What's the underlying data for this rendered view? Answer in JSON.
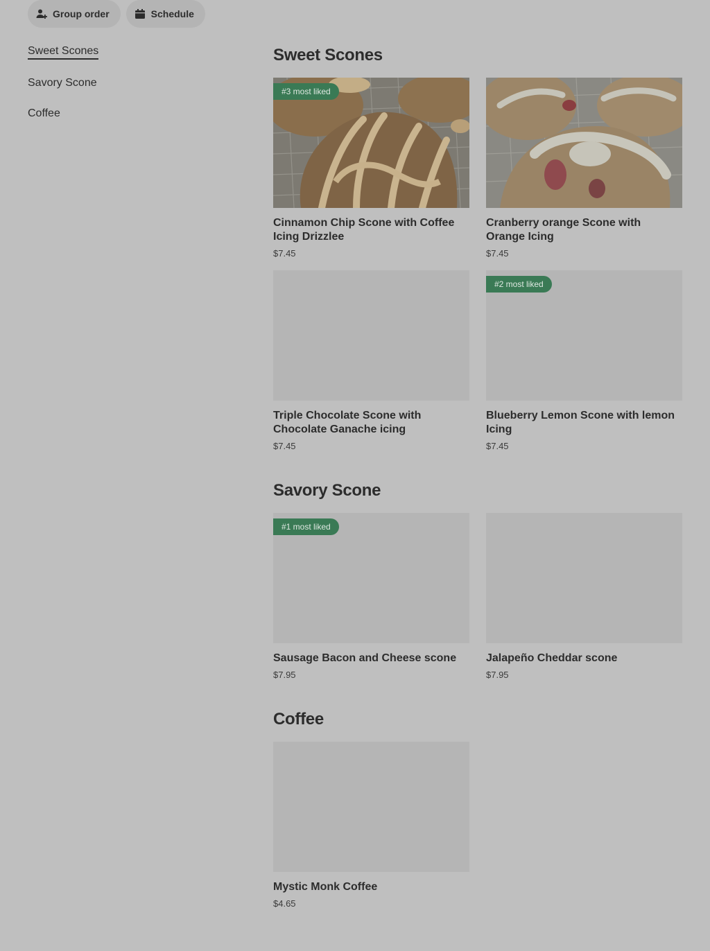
{
  "toolbar": {
    "group_order_label": "Group order",
    "schedule_label": "Schedule"
  },
  "nav": {
    "items": [
      {
        "label": "Sweet Scones",
        "active": true
      },
      {
        "label": "Savory Scone",
        "active": false
      },
      {
        "label": "Coffee",
        "active": false
      }
    ]
  },
  "sections": [
    {
      "title": "Sweet Scones",
      "items": [
        {
          "name": "Cinnamon Chip Scone with Coffee Icing Drizzlee",
          "price": "$7.45",
          "badge": "#3 most liked",
          "image": "scone-photo"
        },
        {
          "name": "Cranberry orange Scone with Orange Icing",
          "price": "$7.45",
          "badge": "",
          "image": "scone-photo"
        },
        {
          "name": "Triple Chocolate Scone with Chocolate Ganache icing",
          "price": "$7.45",
          "badge": "",
          "image": "placeholder"
        },
        {
          "name": "Blueberry Lemon Scone with lemon Icing",
          "price": "$7.45",
          "badge": "#2 most liked",
          "image": "placeholder"
        }
      ]
    },
    {
      "title": "Savory Scone",
      "items": [
        {
          "name": "Sausage Bacon and Cheese scone",
          "price": "$7.95",
          "badge": "#1 most liked",
          "image": "placeholder"
        },
        {
          "name": "Jalapeño Cheddar scone",
          "price": "$7.95",
          "badge": "",
          "image": "placeholder"
        }
      ]
    },
    {
      "title": "Coffee",
      "items": [
        {
          "name": "Mystic Monk Coffee",
          "price": "$4.65",
          "badge": "",
          "image": "placeholder"
        }
      ]
    }
  ],
  "colors": {
    "badge_bg": "#3a7a55",
    "placeholder_bg": "#b5b5b5",
    "page_bg": "#bfbfbf"
  }
}
